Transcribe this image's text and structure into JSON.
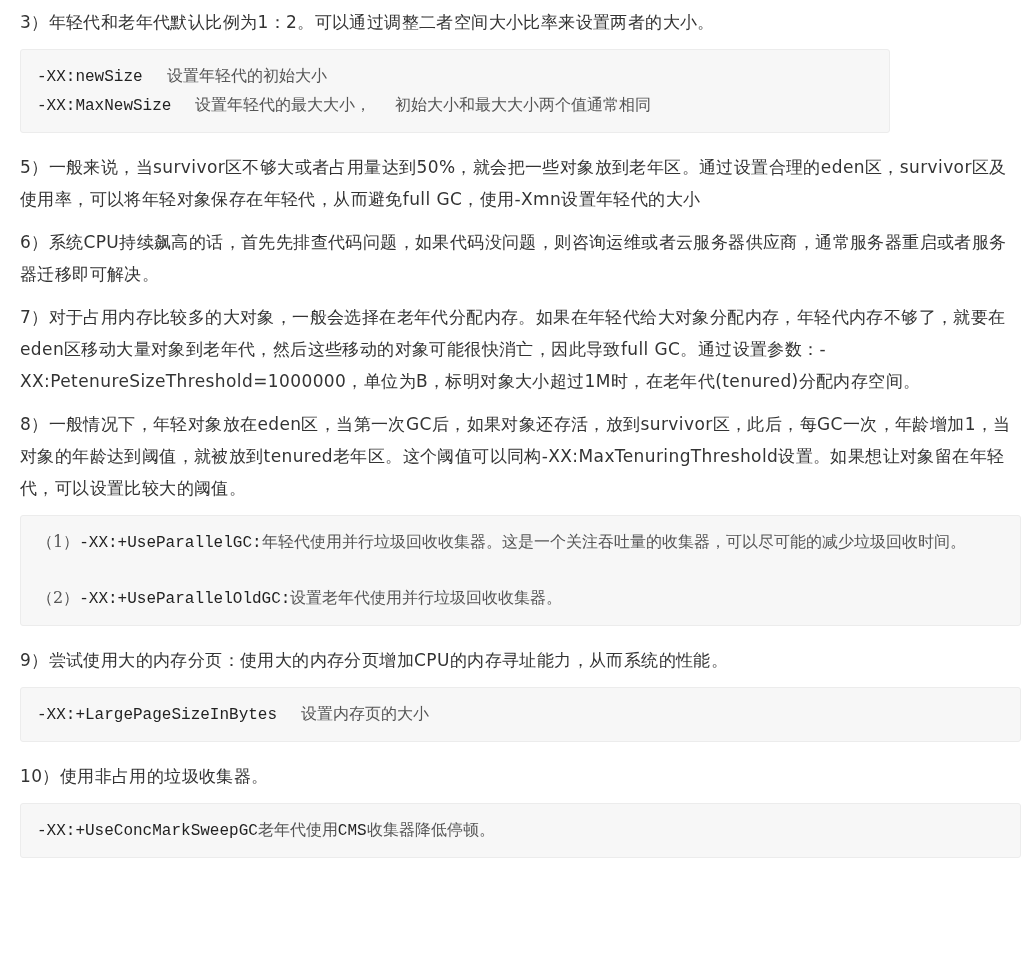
{
  "blocks": [
    {
      "kind": "paragraph",
      "text": "3）年轻代和老年代默认比例为1：2。可以通过调整二者空间大小比率来设置两者的大小。"
    },
    {
      "kind": "code",
      "narrow": true,
      "groups": [
        [
          [
            {
              "kind": "code",
              "text": "-XX:newSize"
            },
            {
              "kind": "text",
              "text": "设置年轻代的初始大小",
              "spaced": true
            }
          ],
          [
            {
              "kind": "code",
              "text": "-XX:MaxNewSize"
            },
            {
              "kind": "text",
              "text": "设置年轻代的最大大小，",
              "spaced": true
            },
            {
              "kind": "text",
              "text": "初始大小和最大大小两个值通常相同",
              "spaced": true
            }
          ]
        ]
      ]
    },
    {
      "kind": "paragraph",
      "text": "5）一般来说，当survivor区不够大或者占用量达到50%，就会把一些对象放到老年区。通过设置合理的eden区，survivor区及使用率，可以将年轻对象保存在年轻代，从而避免full GC，使用-Xmn设置年轻代的大小"
    },
    {
      "kind": "paragraph",
      "text": "6）系统CPU持续飙高的话，首先先排查代码问题，如果代码没问题，则咨询运维或者云服务器供应商，通常服务器重启或者服务器迁移即可解决。"
    },
    {
      "kind": "paragraph",
      "text": "7）对于占用内存比较多的大对象，一般会选择在老年代分配内存。如果在年轻代给大对象分配内存，年轻代内存不够了，就要在eden区移动大量对象到老年代，然后这些移动的对象可能很快消亡，因此导致full GC。通过设置参数：-XX:PetenureSizeThreshold=1000000，单位为B，标明对象大小超过1M时，在老年代(tenured)分配内存空间。"
    },
    {
      "kind": "paragraph",
      "text": "8）一般情况下，年轻对象放在eden区，当第一次GC后，如果对象还存活，放到survivor区，此后，每GC一次，年龄增加1，当对象的年龄达到阈值，就被放到tenured老年区。这个阈值可以同构-XX:MaxTenuringThreshold设置。如果想让对象留在年轻代，可以设置比较大的阈值。"
    },
    {
      "kind": "code",
      "narrow": false,
      "groups": [
        [
          [
            {
              "kind": "text",
              "text": "（1）"
            },
            {
              "kind": "code",
              "text": "-XX:+UseParallelGC:"
            },
            {
              "kind": "text",
              "text": "年轻代使用并行垃圾回收收集器。这是一个关注吞吐量的收集器，可以尽可能的减少垃圾回收时间。"
            }
          ]
        ],
        [
          [
            {
              "kind": "text",
              "text": "（2）"
            },
            {
              "kind": "code",
              "text": "-XX:+UseParallelOldGC:"
            },
            {
              "kind": "text",
              "text": "设置老年代使用并行垃圾回收收集器。"
            }
          ]
        ]
      ]
    },
    {
      "kind": "paragraph",
      "text": "9）尝试使用大的内存分页：使用大的内存分页增加CPU的内存寻址能力，从而系统的性能。"
    },
    {
      "kind": "code",
      "narrow": false,
      "groups": [
        [
          [
            {
              "kind": "code",
              "text": "-XX:+LargePageSizeInBytes"
            },
            {
              "kind": "text",
              "text": "设置内存页的大小",
              "spaced": true
            }
          ]
        ]
      ]
    },
    {
      "kind": "paragraph",
      "text": "10）使用非占用的垃圾收集器。"
    },
    {
      "kind": "code",
      "narrow": false,
      "groups": [
        [
          [
            {
              "kind": "code",
              "text": "-XX:+UseConcMarkSweepGC"
            },
            {
              "kind": "text",
              "text": "老年代使用"
            },
            {
              "kind": "code",
              "text": "CMS"
            },
            {
              "kind": "text",
              "text": "收集器降低停顿。"
            }
          ]
        ]
      ]
    }
  ]
}
